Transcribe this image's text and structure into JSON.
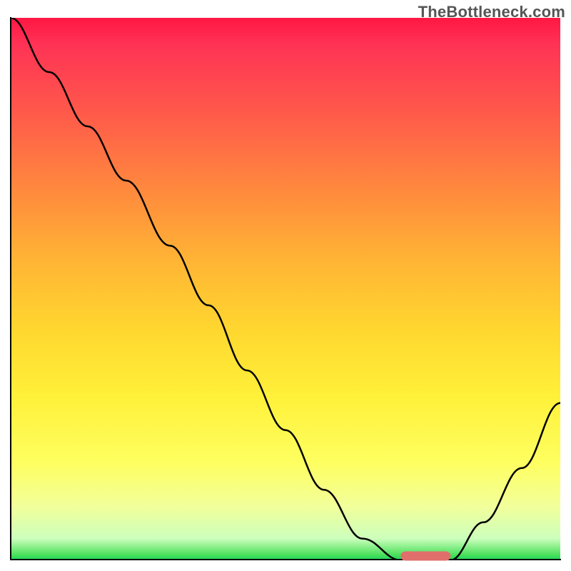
{
  "watermark": "TheBottleneck.com",
  "chart_data": {
    "type": "line",
    "title": "",
    "xlabel": "",
    "ylabel": "",
    "xlim": [
      0,
      1
    ],
    "ylim": [
      0,
      1
    ],
    "x": [
      0.0,
      0.07,
      0.14,
      0.21,
      0.29,
      0.36,
      0.43,
      0.5,
      0.57,
      0.64,
      0.71,
      0.74,
      0.8,
      0.86,
      0.93,
      1.0
    ],
    "values": [
      1.0,
      0.9,
      0.8,
      0.7,
      0.58,
      0.47,
      0.35,
      0.24,
      0.13,
      0.04,
      0.0,
      0.0,
      0.0,
      0.07,
      0.17,
      0.29
    ],
    "marker": {
      "x_min": 0.71,
      "x_max": 0.8,
      "y": 0.008
    },
    "gradient": {
      "top_color": "#ff1744",
      "mid_color": "#ffd82f",
      "bottom_color": "#18d45a"
    }
  }
}
